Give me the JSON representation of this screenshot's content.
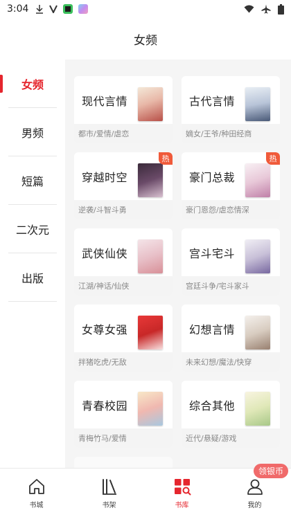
{
  "status_bar": {
    "time": "3:04",
    "left_icons": [
      "download-icon",
      "v-icon",
      "app-icon-green",
      "app-icon-colorful"
    ],
    "right_icons": [
      "wifi-icon",
      "airplane-icon",
      "battery-icon"
    ]
  },
  "header": {
    "title": "女频"
  },
  "sidebar": {
    "items": [
      {
        "label": "女频",
        "active": true
      },
      {
        "label": "男频",
        "active": false
      },
      {
        "label": "短篇",
        "active": false
      },
      {
        "label": "二次元",
        "active": false
      },
      {
        "label": "出版",
        "active": false
      }
    ]
  },
  "categories": [
    {
      "title": "现代言情",
      "tags": "都市/爱情/虐恋",
      "hot": ""
    },
    {
      "title": "古代言情",
      "tags": "嫡女/王爷/种田经商",
      "hot": ""
    },
    {
      "title": "穿越时空",
      "tags": "逆袭/斗智斗勇",
      "hot": "热"
    },
    {
      "title": "豪门总裁",
      "tags": "豪门恩怨/虐恋情深",
      "hot": "热"
    },
    {
      "title": "武侠仙侠",
      "tags": "江湖/神话/仙侠",
      "hot": ""
    },
    {
      "title": "宫斗宅斗",
      "tags": "宫廷斗争/宅斗家斗",
      "hot": ""
    },
    {
      "title": "女尊女强",
      "tags": "拌猪吃虎/无敌",
      "hot": ""
    },
    {
      "title": "幻想言情",
      "tags": "未来幻想/魔法/快穿",
      "hot": ""
    },
    {
      "title": "青春校园",
      "tags": "青梅竹马/爱情",
      "hot": ""
    },
    {
      "title": "综合其他",
      "tags": "近代/悬疑/游戏",
      "hot": ""
    }
  ],
  "floating_button": {
    "label": "领银币"
  },
  "bottom_nav": {
    "items": [
      {
        "label": "书城",
        "icon": "home-icon",
        "active": false
      },
      {
        "label": "书架",
        "icon": "bookshelf-icon",
        "active": false
      },
      {
        "label": "书库",
        "icon": "library-icon",
        "active": true
      },
      {
        "label": "我的",
        "icon": "profile-icon",
        "active": false
      }
    ]
  },
  "colors": {
    "accent": "#e5262e",
    "hot_badge": "#f05a3a",
    "coin_button": "#f06a6a",
    "content_bg": "#f5f5f5"
  }
}
